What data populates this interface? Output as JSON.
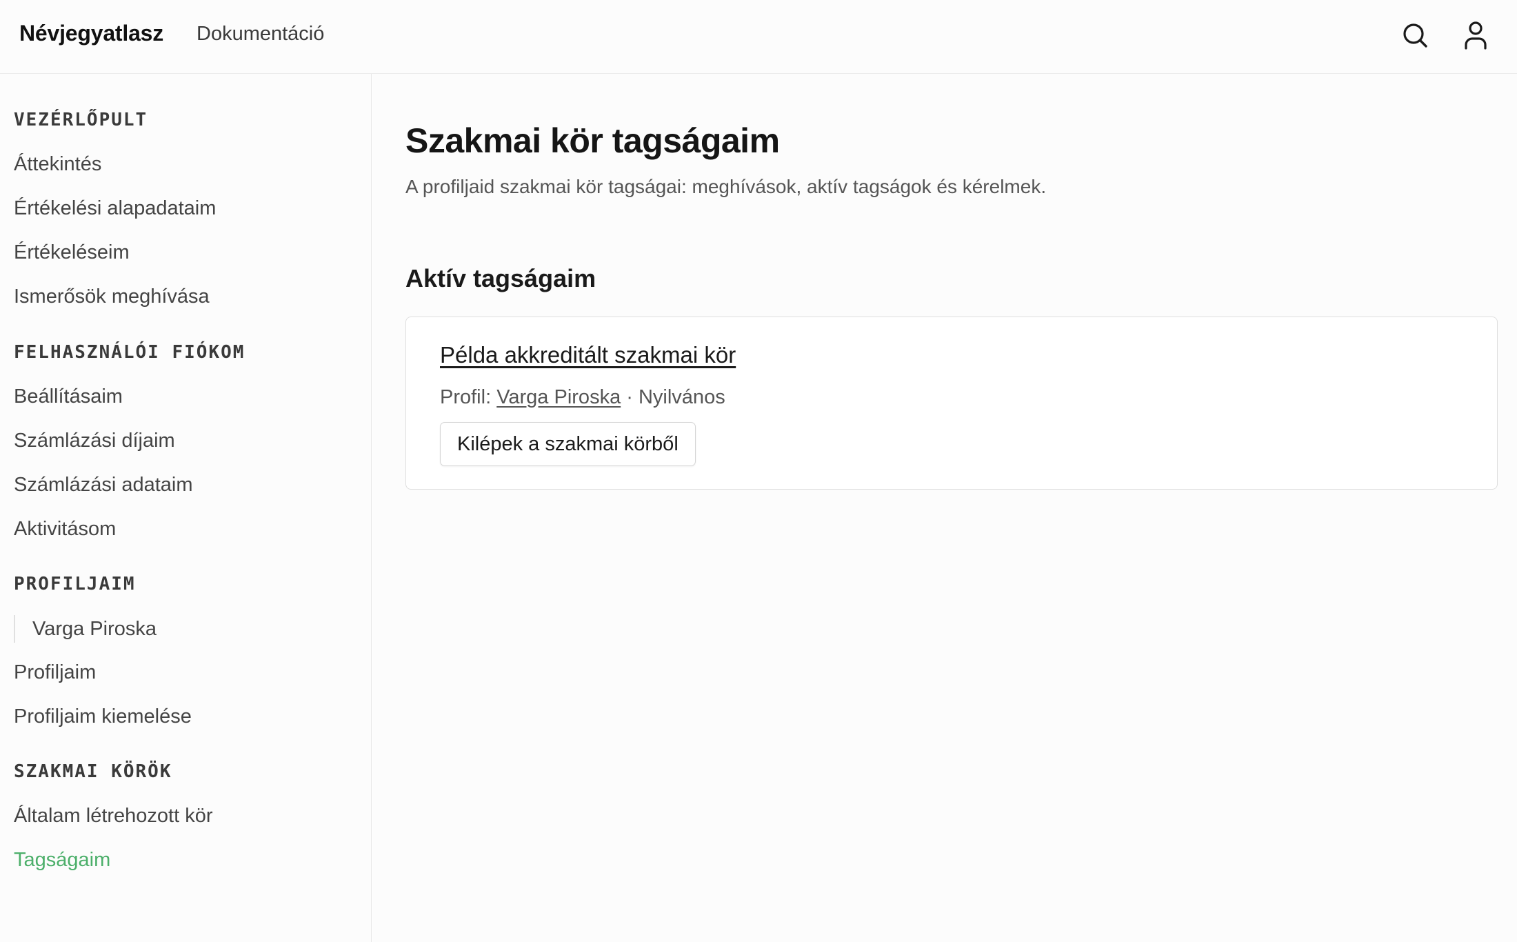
{
  "header": {
    "brand": "Névjegyatlasz",
    "nav_docs": "Dokumentáció"
  },
  "icons": {
    "search": "search-icon",
    "user": "user-icon"
  },
  "sidebar": {
    "sections": [
      {
        "heading": "VEZÉRLŐPULT",
        "items": [
          "Áttekintés",
          "Értékelési alapadataim",
          "Értékeléseim",
          "Ismerősök meghívása"
        ]
      },
      {
        "heading": "FELHASZNÁLÓI FIÓKOM",
        "items": [
          "Beállításaim",
          "Számlázási díjaim",
          "Számlázási adataim",
          "Aktivitásom"
        ]
      },
      {
        "heading": "PROFILJAIM",
        "subitems": [
          "Varga Piroska"
        ],
        "items": [
          "Profiljaim",
          "Profiljaim kiemelése"
        ]
      },
      {
        "heading": "SZAKMAI KÖRÖK",
        "items": [
          "Általam létrehozott kör",
          "Tagságaim"
        ]
      }
    ],
    "active_item": "Tagságaim"
  },
  "main": {
    "title": "Szakmai kör tagságaim",
    "subtitle": "A profiljaid szakmai kör tagságai: meghívások, aktív tagságok és kérelmek.",
    "section_title": "Aktív tagságaim",
    "membership": {
      "circle_name": "Példa akkreditált szakmai kör",
      "profile_label": "Profil:",
      "profile_name": "Varga Piroska",
      "visibility": "· Nyilvános",
      "leave_button": "Kilépek a szakmai körből"
    }
  },
  "colors": {
    "active_link": "#4caf6a",
    "text": "#1a1a1a",
    "muted": "#555555"
  }
}
